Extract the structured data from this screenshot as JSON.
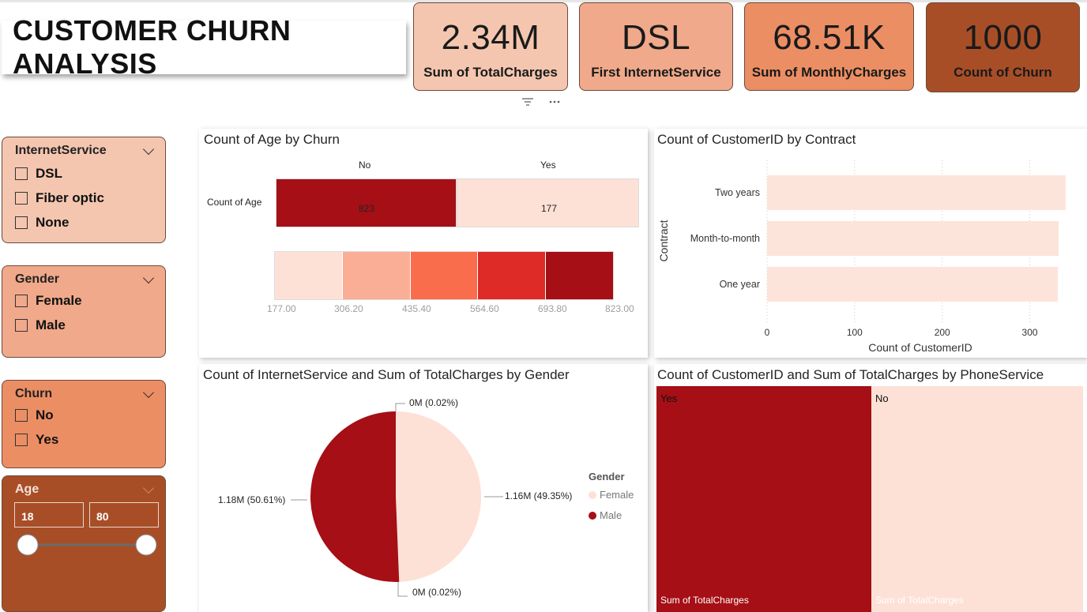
{
  "title": "CUSTOMER CHURN ANALYSIS",
  "cards": [
    {
      "value": "2.34M",
      "label": "Sum of TotalCharges",
      "color": "#f4c6b0"
    },
    {
      "value": "DSL",
      "label": "First InternetService",
      "color": "#f0a98a"
    },
    {
      "value": "68.51K",
      "label": "Sum of MonthlyCharges",
      "color": "#ec8e64"
    },
    {
      "value": "1000",
      "label": "Count of Churn",
      "color": "#a84e27"
    }
  ],
  "slicers": {
    "internet": {
      "header": "InternetService",
      "options": [
        "DSL",
        "Fiber optic",
        "None"
      ]
    },
    "gender": {
      "header": "Gender",
      "options": [
        "Female",
        "Male"
      ]
    },
    "churn": {
      "header": "Churn",
      "options": [
        "No",
        "Yes"
      ]
    },
    "age": {
      "header": "Age",
      "min": "18",
      "max": "80"
    }
  },
  "matrix": {
    "title": "Count of Age by Churn",
    "row_label": "Count of Age",
    "columns": [
      "No",
      "Yes"
    ],
    "values": [
      "823",
      "177"
    ],
    "scale_ticks": [
      "177.00",
      "306.20",
      "435.40",
      "564.60",
      "693.80",
      "823.00"
    ],
    "scale_colors": [
      "#fde1d6",
      "#f9ae95",
      "#f96d4d",
      "#de2b27",
      "#a50f15"
    ]
  },
  "contract_chart": {
    "title": "Count of CustomerID by Contract",
    "xlabel": "Count of CustomerID",
    "ylabel": "Contract",
    "xticks": [
      "0",
      "100",
      "200",
      "300"
    ]
  },
  "pie_chart": {
    "title": "Count of InternetService and Sum of TotalCharges by Gender",
    "legend_title": "Gender",
    "labels": {
      "top": "0M (0.02%)",
      "right": "1.16M (49.35%)",
      "left": "1.18M (50.61%)",
      "bottom": "0M (0.02%)"
    }
  },
  "treemap": {
    "title": "Count of CustomerID and Sum of TotalCharges by PhoneService",
    "tiles": [
      {
        "label": "Yes",
        "sub": "Sum of TotalCharges"
      },
      {
        "label": "No",
        "sub": "Sum of TotalCharges"
      }
    ]
  },
  "chart_data": [
    {
      "type": "bar",
      "title": "Count of CustomerID by Contract",
      "categories": [
        "Two years",
        "Month-to-month",
        "One year"
      ],
      "values": [
        341,
        333,
        332
      ],
      "xlabel": "Count of CustomerID",
      "ylabel": "Contract",
      "xlim": [
        0,
        350
      ],
      "grid": true,
      "color": "#fde4da"
    },
    {
      "type": "pie",
      "title": "Count of InternetService and Sum of TotalCharges by Gender",
      "categories": [
        "Female",
        "Male"
      ],
      "values": [
        49.37,
        50.63
      ],
      "colors": [
        "#fde1d6",
        "#a50f15"
      ],
      "legend": "right"
    }
  ]
}
